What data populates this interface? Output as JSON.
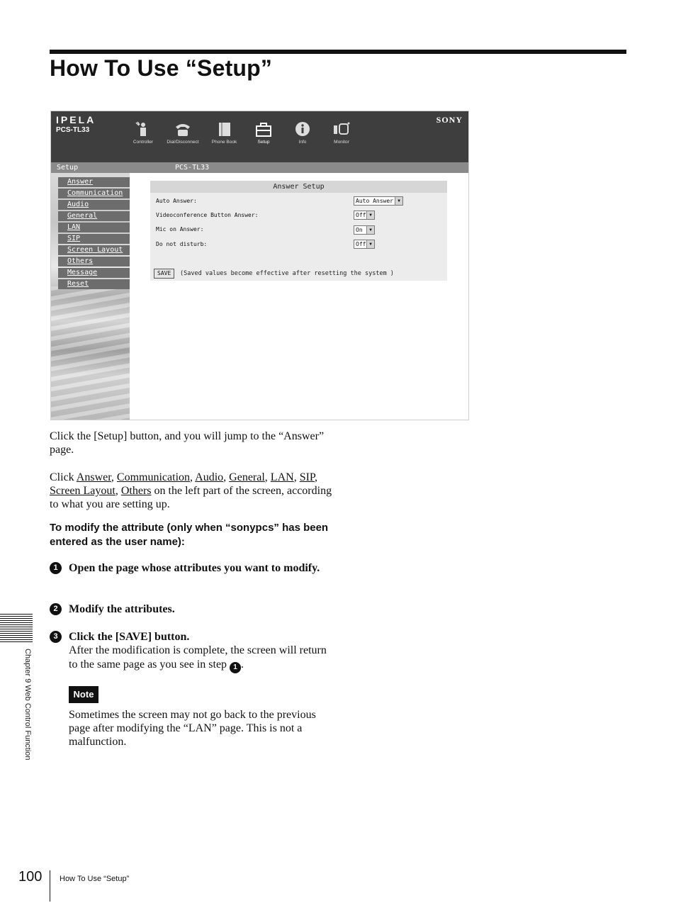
{
  "page": {
    "title": "How To Use “Setup”",
    "page_number": "100",
    "footer_text": "How To Use “Setup”",
    "side_tab": "Chapter 9  Web Control Function"
  },
  "screenshot": {
    "logo": "IPELA",
    "model": "PCS-TL33",
    "brand": "SONY",
    "toolbar": [
      {
        "label": "Controller",
        "icon": "controller-icon"
      },
      {
        "label": "Dial/Disconnect",
        "icon": "phone-icon"
      },
      {
        "label": "Phone Book",
        "icon": "phonebook-icon"
      },
      {
        "label": "Setup",
        "icon": "toolbox-icon"
      },
      {
        "label": "Info",
        "icon": "info-icon"
      },
      {
        "label": "Monitor",
        "icon": "monitor-icon"
      }
    ],
    "subbar_left": "Setup",
    "subbar_right": "PCS-TL33",
    "menu": [
      "Answer",
      "Communication",
      "Audio",
      "General",
      "LAN",
      "SIP",
      "Screen Layout",
      "Others",
      "Message",
      "Reset"
    ],
    "panel_title": "Answer Setup",
    "fields": [
      {
        "label": "Auto Answer:",
        "value": "Auto Answer"
      },
      {
        "label": "Videoconference Button Answer:",
        "value": "Off"
      },
      {
        "label": "Mic on Answer:",
        "value": "On"
      },
      {
        "label": "Do not disturb:",
        "value": "Off"
      }
    ],
    "save_label": "SAVE",
    "save_note": "(Saved values become effective after resetting the system )"
  },
  "body": {
    "para1": "Click the [Setup] button, and you will jump to the “Answer” page.",
    "para2_prefix": "Click",
    "para2_links": [
      "Answer",
      "Communication",
      "Audio",
      "General",
      "LAN",
      "SIP",
      "Screen Layout",
      "Others"
    ],
    "para2_suffix": "on the left part of the screen, according to what you are setting up.",
    "heading": "To modify the attribute (only when “sonypcs” has been entered as the user name):",
    "steps": [
      {
        "num": "1",
        "text": "Open the page whose attributes you want to modify."
      },
      {
        "num": "2",
        "text": "Modify the attributes."
      },
      {
        "num": "3",
        "text": "Click the [SAVE] button."
      }
    ],
    "step3_detail": "After the modification is complete, the screen will return to the same page as you see in step",
    "step3_ref": "1",
    "note_label": "Note",
    "note_text": "Sometimes the screen may not go back to the previous page after modifying the “LAN” page. This is not a malfunction."
  }
}
